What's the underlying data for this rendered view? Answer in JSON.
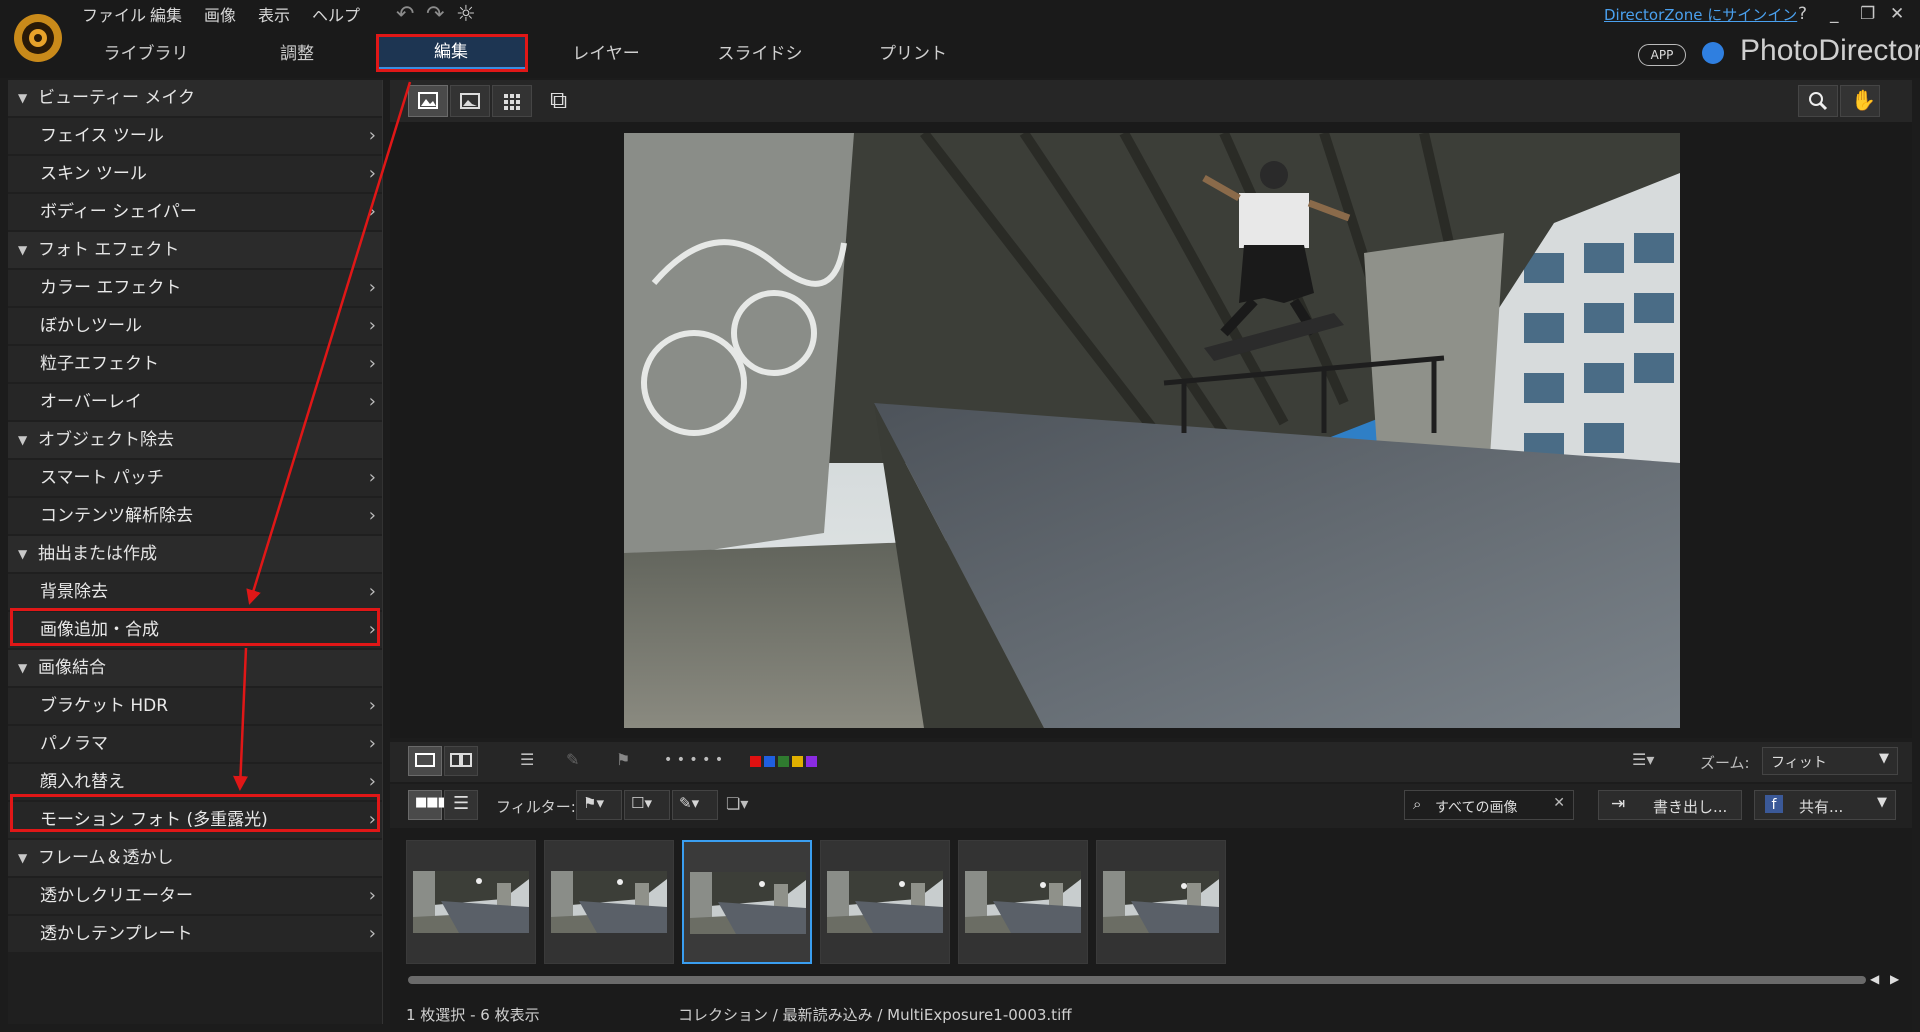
{
  "menu": {
    "file": "ファイル",
    "edit": "編集",
    "image": "画像",
    "view": "表示",
    "help": "ヘルプ"
  },
  "modules": {
    "library": "ライブラリー",
    "adjust": "調整",
    "edit": "編集",
    "layers": "レイヤー",
    "slideshow": "スライドショー",
    "print": "プリント"
  },
  "header": {
    "signin": "DirectorZone にサインイン",
    "help_glyph": "?",
    "app_badge": "APP",
    "brand": "PhotoDirector"
  },
  "sidebar": {
    "categories": [
      {
        "label": "ビューティー メイク",
        "items": [
          "フェイス ツール",
          "スキン ツール",
          "ボディー シェイパー"
        ]
      },
      {
        "label": "フォト エフェクト",
        "items": [
          "カラー エフェクト",
          "ぼかしツール",
          "粒子エフェクト",
          "オーバーレイ"
        ]
      },
      {
        "label": "オブジェクト除去",
        "items": [
          "スマート パッチ",
          "コンテンツ解析除去"
        ]
      },
      {
        "label": "抽出または作成",
        "items": [
          "背景除去",
          "画像追加・合成"
        ]
      },
      {
        "label": "画像結合",
        "items": [
          "ブラケット HDR",
          "パノラマ",
          "顔入れ替え",
          "モーション フォト (多重露光)"
        ]
      },
      {
        "label": "フレーム＆透かし",
        "items": [
          "透かしクリエーター",
          "透かしテンプレート"
        ]
      }
    ]
  },
  "toolbar": {
    "zoom_label": "ズーム:",
    "zoom_value": "フィット",
    "filter_label": "フィルター:",
    "search_value": "すべての画像",
    "export_label": "書き出し...",
    "share_label": "共有...",
    "dots": "• • • • •",
    "color_labels": [
      "#e01010",
      "#1f5fe0",
      "#2f7a2f",
      "#e0b000",
      "#8a2be2"
    ]
  },
  "status": {
    "selection": "1 枚選択 - 6 枚表示",
    "path": "コレクション / 最新読み込み / MultiExposure1-0003.tiff"
  },
  "filmstrip": {
    "count": 6,
    "selected_index": 2
  },
  "colors": {
    "accent": "#3a8de0",
    "highlight": "#e01717"
  }
}
